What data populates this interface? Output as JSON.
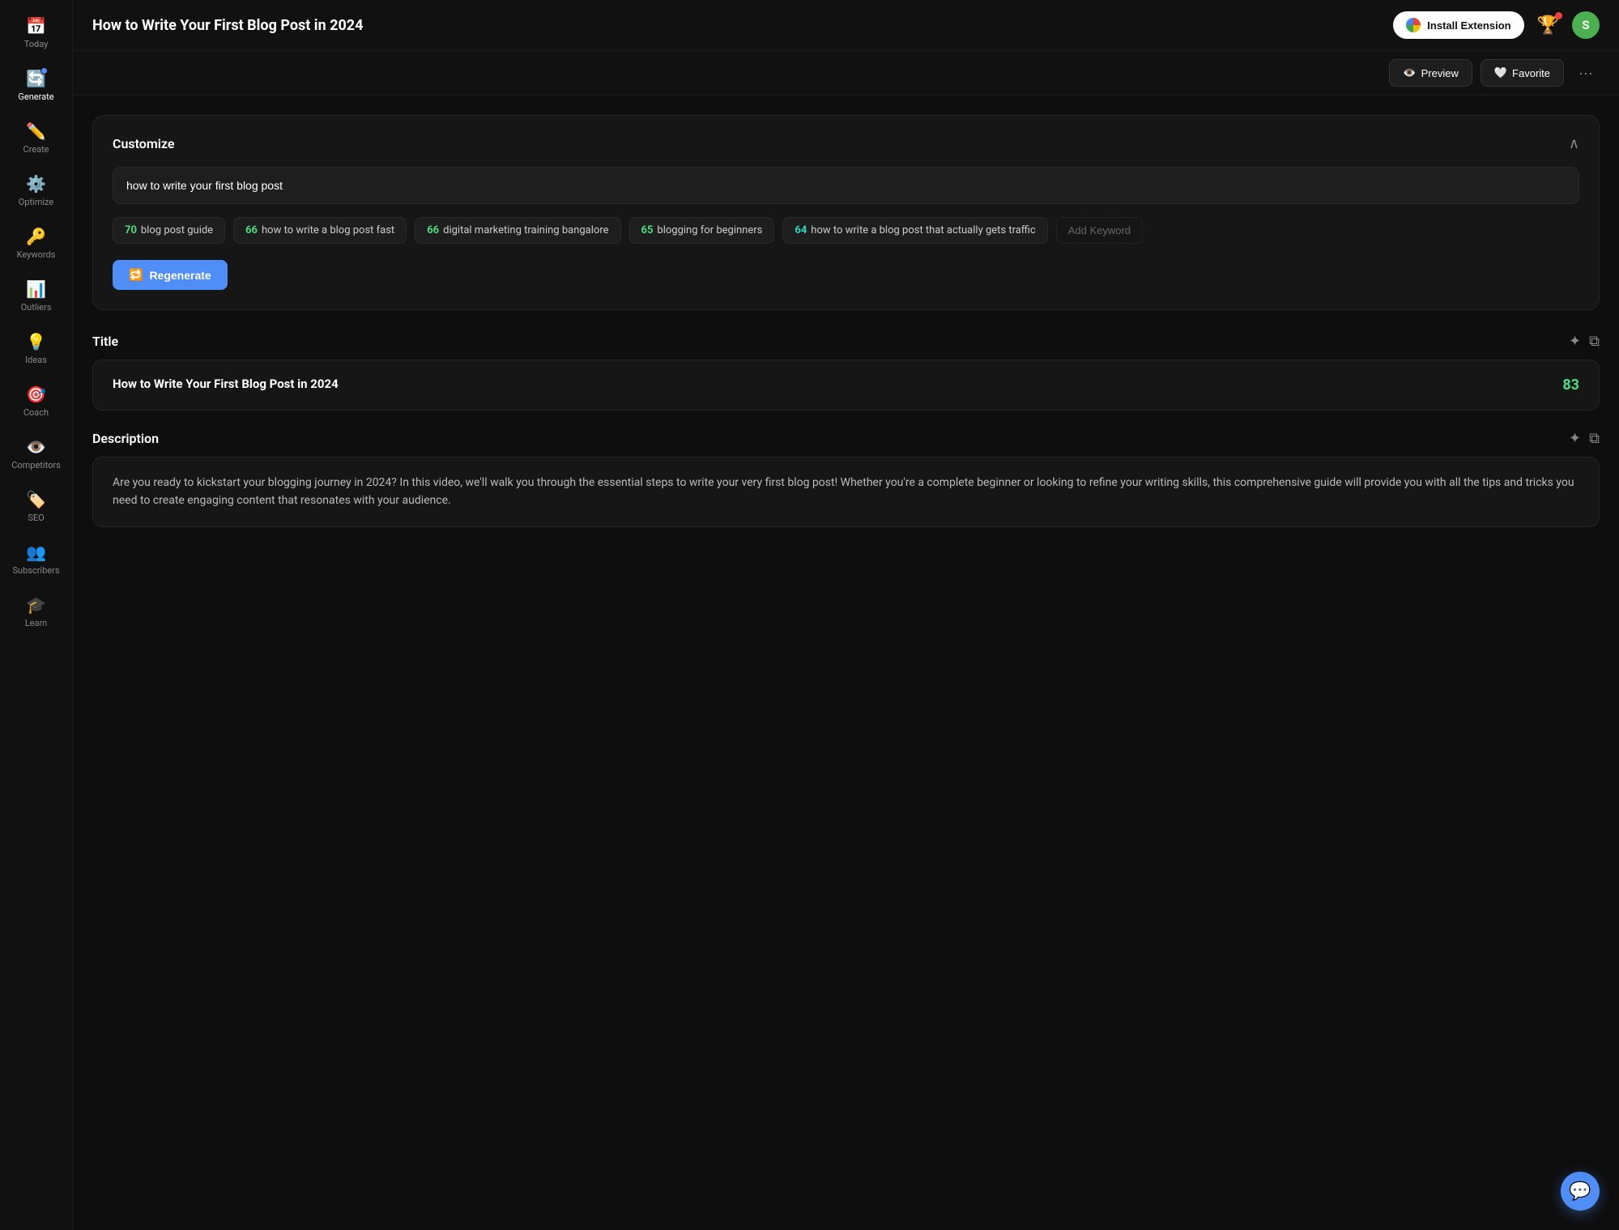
{
  "sidebar": {
    "items": [
      {
        "id": "today",
        "label": "Today",
        "icon": "📅",
        "active": false
      },
      {
        "id": "generate",
        "label": "Generate",
        "icon": "🔄",
        "active": true,
        "dot": true
      },
      {
        "id": "create",
        "label": "Create",
        "icon": "✏️",
        "active": false
      },
      {
        "id": "optimize",
        "label": "Optimize",
        "icon": "⚙️",
        "active": false
      },
      {
        "id": "keywords",
        "label": "Keywords",
        "icon": "🔑",
        "active": false
      },
      {
        "id": "outliers",
        "label": "Outliers",
        "icon": "📊",
        "active": false
      },
      {
        "id": "ideas",
        "label": "Ideas",
        "icon": "💡",
        "active": false
      },
      {
        "id": "coach",
        "label": "Coach",
        "icon": "🎯",
        "active": false
      },
      {
        "id": "competitors",
        "label": "Competitors",
        "icon": "👁️",
        "active": false
      },
      {
        "id": "seo",
        "label": "SEO",
        "icon": "🏷️",
        "active": false
      },
      {
        "id": "subscribers",
        "label": "Subscribers",
        "icon": "👥",
        "active": false
      },
      {
        "id": "learn",
        "label": "Learn",
        "icon": "🎓",
        "active": false
      }
    ]
  },
  "header": {
    "title": "How to Write Your First Blog Post in 2024",
    "install_btn": "Install Extension",
    "preview_label": "Preview",
    "favorite_label": "Favorite",
    "avatar_letter": "S"
  },
  "customize": {
    "title": "Customize",
    "input_value": "how to write your first blog post",
    "keywords": [
      {
        "num": "70",
        "text": "blog post guide",
        "color": "green"
      },
      {
        "num": "66",
        "text": "how to write a blog post fast",
        "color": "green"
      },
      {
        "num": "66",
        "text": "digital marketing training bangalore",
        "color": "green"
      },
      {
        "num": "65",
        "text": "blogging for beginners",
        "color": "green"
      },
      {
        "num": "64",
        "text": "how to write a blog post that actually gets traffic",
        "color": "teal"
      }
    ],
    "add_keyword_label": "Add Keyword",
    "regenerate_label": "Regenerate"
  },
  "title_section": {
    "label": "Title",
    "title_text": "How to Write Your First Blog Post in 2024",
    "score": "83"
  },
  "description_section": {
    "label": "Description",
    "description_text": "Are you ready to kickstart your blogging journey in 2024? In this video, we'll walk you through the essential steps to write your very first blog post! Whether you're a complete beginner or looking to refine your writing skills, this comprehensive guide will provide you with all the tips and tricks you need to create engaging content that resonates with your audience."
  },
  "chat_icon": "💬"
}
